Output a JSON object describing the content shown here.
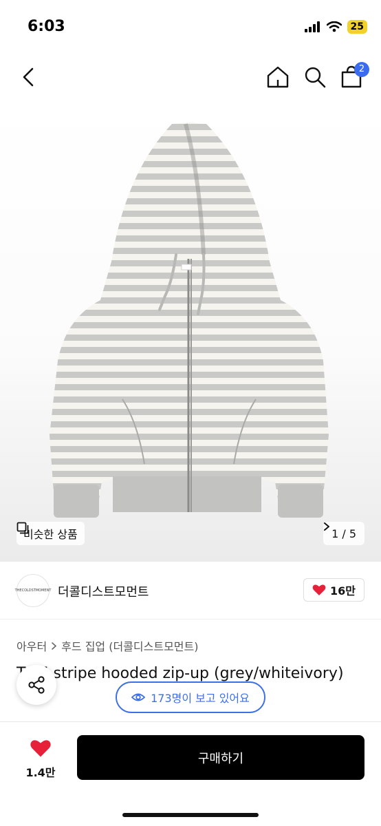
{
  "status_bar": {
    "time": "6:03",
    "battery": "25"
  },
  "header": {
    "back_icon": "chevron-left-icon",
    "home_icon": "home-icon",
    "search_icon": "search-icon",
    "bag_icon": "shopping-bag-icon",
    "cart_count": "2"
  },
  "gallery": {
    "similar_label": "비슷한 상품",
    "page_indicator": "1 / 5"
  },
  "seller": {
    "logo_text": "THECOLDSTMOMENT",
    "name": "더콜디스트모먼트",
    "favorite_count": "16만"
  },
  "product": {
    "category_root": "아우터",
    "category_sub": "후드 집업 (더콜디스트모먼트)",
    "title": "TCM stripe hooded zip-up (grey/whiteivory)"
  },
  "viewers": {
    "text": "173명이 보고 있어요"
  },
  "bottom_bar": {
    "like_count": "1.4만",
    "buy_label": "구매하기"
  },
  "colors": {
    "accent_blue": "#3d6fe8",
    "heart_red": "#e8213a",
    "stripe_grey": "#c9c9c7",
    "stripe_ivory": "#f6f4ee",
    "battery_yellow": "#f2d12a"
  }
}
